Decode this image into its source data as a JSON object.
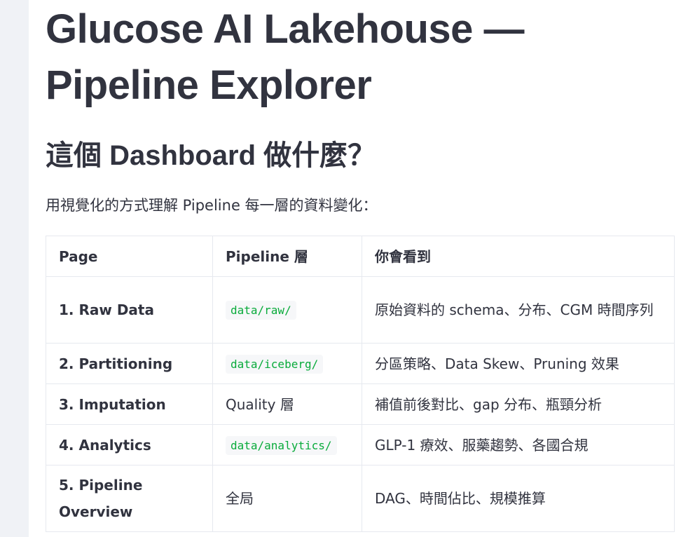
{
  "main": {
    "title": "Glucose AI Lakehouse — Pipeline Explorer",
    "section_title": "這個 Dashboard 做什麼？",
    "intro": "用視覺化的方式理解 Pipeline 每一層的資料變化："
  },
  "table": {
    "headers": [
      "Page",
      "Pipeline 層",
      "你會看到"
    ],
    "rows": [
      {
        "page": "1. Raw Data",
        "layer": "data/raw/",
        "layer_is_code": true,
        "see": "原始資料的 schema、分布、CGM 時間序列"
      },
      {
        "page": "2. Partitioning",
        "layer": "data/iceberg/",
        "layer_is_code": true,
        "see": "分區策略、Data Skew、Pruning 效果"
      },
      {
        "page": "3. Imputation",
        "layer": "Quality 層",
        "layer_is_code": false,
        "see": "補值前後對比、gap 分布、瓶頸分析"
      },
      {
        "page": "4. Analytics",
        "layer": "data/analytics/",
        "layer_is_code": true,
        "see": "GLP-1 療效、服藥趨勢、各國合規"
      },
      {
        "page": "5. Pipeline Overview",
        "layer": "全局",
        "layer_is_code": false,
        "see": "DAG、時間佔比、規模推算"
      }
    ]
  },
  "colors": {
    "text": "#31333f",
    "code_text": "#09ab3b",
    "code_bg": "#f6f7f9",
    "sidebar_bg": "#f0f2f6",
    "table_border": "#e6e9ef"
  }
}
